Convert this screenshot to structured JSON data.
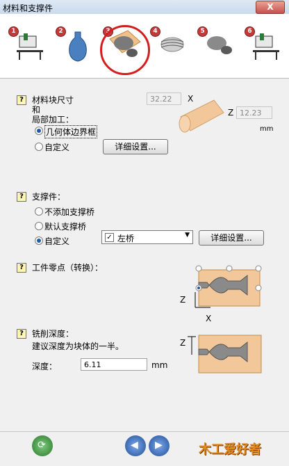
{
  "window": {
    "title": "材料和支撑件",
    "close_label": "X"
  },
  "steps": [
    {
      "number": "1",
      "icon": "machine-icon"
    },
    {
      "number": "2",
      "icon": "vase-model-icon"
    },
    {
      "number": "3",
      "icon": "material-block-icon",
      "active": true
    },
    {
      "number": "4",
      "icon": "toolpath-icon"
    },
    {
      "number": "5",
      "icon": "model-preview-icon"
    },
    {
      "number": "6",
      "icon": "output-machine-icon"
    }
  ],
  "material": {
    "help": "?",
    "label": "材料块尺寸",
    "label2": "和",
    "label3": "局部加工：",
    "x_value": "32.22",
    "x_label": "X",
    "z_label": "Z",
    "z_value": "12.23",
    "unit": "mm",
    "option1": "几何体边界框",
    "option2": "自定义",
    "details_button": "详细设置..."
  },
  "support": {
    "help": "?",
    "label": "支撑件：",
    "option1": "不添加支撑桥",
    "option2": "默认支撑桥",
    "option3": "自定义",
    "select_value": "左桥",
    "details_button": "详细设置..."
  },
  "zero": {
    "help": "?",
    "label": "工件零点（转换）：",
    "z_axis": "Z",
    "x_axis": "X"
  },
  "depth": {
    "help": "?",
    "label": "铣削深度：",
    "hint": "建议深度为块体的一半。",
    "field_label": "深度：",
    "value": "6.11",
    "unit": "mm",
    "z_axis": "Z"
  },
  "footer": {
    "watermark": "木工爱好者"
  }
}
